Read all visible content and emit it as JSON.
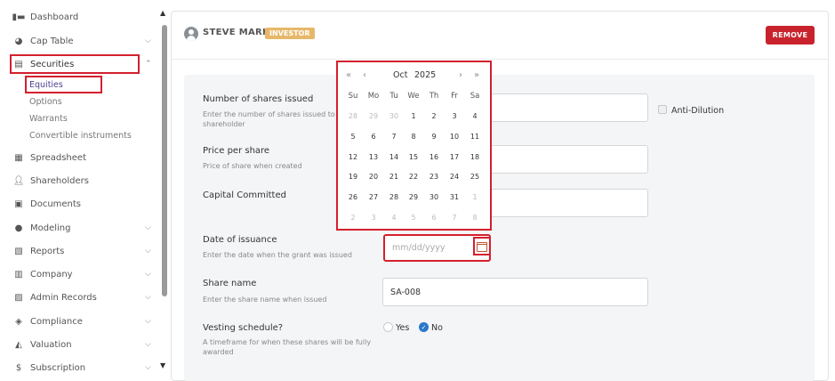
{
  "sidebar": {
    "items": [
      {
        "label": "Dashboard",
        "icon": "dashboard-icon",
        "chevron": ""
      },
      {
        "label": "Cap Table",
        "icon": "pie-chart-icon",
        "chevron": "⌵"
      },
      {
        "label": "Securities",
        "icon": "clipboard-icon",
        "chevron": "⌃"
      },
      {
        "label": "Spreadsheet",
        "icon": "table-icon",
        "chevron": ""
      },
      {
        "label": "Shareholders",
        "icon": "person-icon",
        "chevron": ""
      },
      {
        "label": "Documents",
        "icon": "document-icon",
        "chevron": ""
      },
      {
        "label": "Modeling",
        "icon": "lightbulb-icon",
        "chevron": "⌵"
      },
      {
        "label": "Reports",
        "icon": "report-icon",
        "chevron": "⌵"
      },
      {
        "label": "Company",
        "icon": "building-icon",
        "chevron": "⌵"
      },
      {
        "label": "Admin Records",
        "icon": "records-icon",
        "chevron": "⌵"
      },
      {
        "label": "Compliance",
        "icon": "shield-icon",
        "chevron": "⌵"
      },
      {
        "label": "Valuation",
        "icon": "valuation-icon",
        "chevron": "⌵"
      },
      {
        "label": "Subscription",
        "icon": "dollar-icon",
        "chevron": "⌵"
      }
    ],
    "sub_items": [
      "Equities",
      "Options",
      "Warrants",
      "Convertible instruments"
    ]
  },
  "header": {
    "name": "STEVE MARK",
    "badge": "INVESTOR",
    "remove_label": "REMOVE"
  },
  "form": {
    "shares_label": "Number of shares issued",
    "shares_help": "Enter the number of shares issued to shareholder",
    "anti_dilution_label": "Anti-Dilution",
    "price_label": "Price per share",
    "price_help": "Price of share when created",
    "capital_label": "Capital Committed",
    "date_label": "Date of issuance",
    "date_help": "Enter the date when the grant was issued",
    "date_placeholder": "mm/dd/yyyy",
    "share_name_label": "Share name",
    "share_name_help": "Enter the share name when issued",
    "share_name_value": "SA-008",
    "vesting_label": "Vesting schedule?",
    "vesting_help": "A timeframe for when these shares will be fully awarded",
    "vesting_yes": "Yes",
    "vesting_no": "No"
  },
  "picker": {
    "month": "Oct",
    "year": "2025",
    "nav_prev_year": "«",
    "nav_prev": "‹",
    "nav_next": "›",
    "nav_next_year": "»",
    "weekdays": [
      "Su",
      "Mo",
      "Tu",
      "We",
      "Th",
      "Fr",
      "Sa"
    ],
    "weeks": [
      [
        "28",
        "29",
        "30",
        "1",
        "2",
        "3",
        "4"
      ],
      [
        "5",
        "6",
        "7",
        "8",
        "9",
        "10",
        "11"
      ],
      [
        "12",
        "13",
        "14",
        "15",
        "16",
        "17",
        "18"
      ],
      [
        "19",
        "20",
        "21",
        "22",
        "23",
        "24",
        "25"
      ],
      [
        "26",
        "27",
        "28",
        "29",
        "30",
        "31",
        "1"
      ],
      [
        "2",
        "3",
        "4",
        "5",
        "6",
        "7",
        "8"
      ]
    ]
  }
}
